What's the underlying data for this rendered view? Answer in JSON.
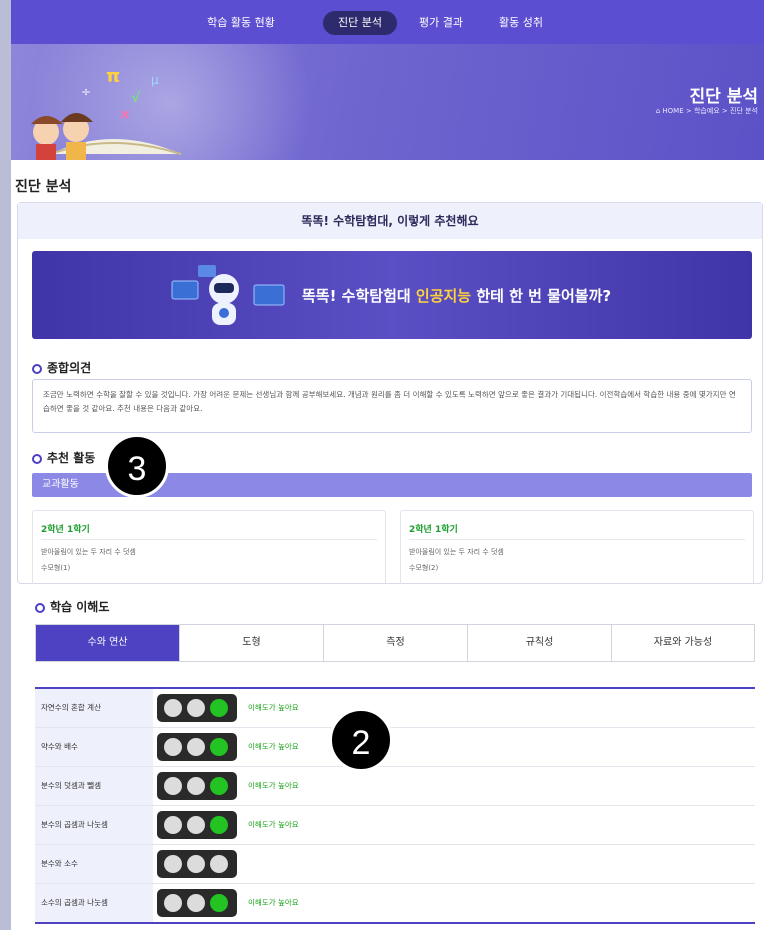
{
  "nav": {
    "items": [
      {
        "label": "학습 활동 현황",
        "active": false
      },
      {
        "label": "진단 분석",
        "active": true
      },
      {
        "label": "평가 결과",
        "active": false
      },
      {
        "label": "활동 성취",
        "active": false
      }
    ]
  },
  "banner": {
    "title": "진단 분석",
    "breadcrumb": "⌂ HOME > 학습예요 > 진단 분석"
  },
  "page_title": "진단 분석",
  "recommend": {
    "heading": "똑똑! 수학탐험대, 이렇게 추천해요",
    "ai_banner": {
      "prefix": "똑똑! 수학탐험대 ",
      "highlight": "인공지능",
      "suffix": " 한테 한 번 물어볼까?"
    },
    "opinion_title": "종합의견",
    "opinion_text": "조금만 노력하면 수학을 잘할 수 있을 것입니다. 가장 어려운 문제는 선생님과 함께 공부해보세요. 개념과 원리를 좀 더 이해할 수 있도록 노력하면 앞으로 좋은 결과가 기대됩니다. 이전학습에서 학습한 내용 중에 몇가지만 연습하면 좋을 것 같아요. 추천 내용은 다음과 같아요.",
    "activity_title": "추천 활동",
    "subject_bar": "교과활동",
    "activities": [
      {
        "semester": "2학년 1학기",
        "title": "받아올림이 있는 두 자리 수 덧셈",
        "sub": "수모형(1)"
      },
      {
        "semester": "2학년 1학기",
        "title": "받아올림이 있는 두 자리 수 덧셈",
        "sub": "수모형(2)"
      }
    ]
  },
  "understanding": {
    "title": "학습 이해도",
    "tabs": [
      {
        "label": "수와 연산",
        "active": true
      },
      {
        "label": "도형",
        "active": false
      },
      {
        "label": "측정",
        "active": false
      },
      {
        "label": "규칙성",
        "active": false
      },
      {
        "label": "자료와 가능성",
        "active": false
      }
    ],
    "rows": [
      {
        "label": "자연수의 혼합 계산",
        "lit": 3,
        "status": "이해도가 높아요"
      },
      {
        "label": "약수와 배수",
        "lit": 3,
        "status": "이해도가 높아요"
      },
      {
        "label": "분수의 덧셈과 뺄셈",
        "lit": 3,
        "status": "이해도가 높아요"
      },
      {
        "label": "분수의 곱셈과 나눗셈",
        "lit": 3,
        "status": "이해도가 높아요"
      },
      {
        "label": "분수와 소수",
        "lit": 0,
        "status": ""
      },
      {
        "label": "소수의 곱셈과 나눗셈",
        "lit": 3,
        "status": "이해도가 높아요"
      }
    ]
  },
  "badges": {
    "b3": "3",
    "b2": "2"
  },
  "colors": {
    "primary": "#4d43c2",
    "green": "#22c322",
    "nav": "#5c4ed0"
  }
}
